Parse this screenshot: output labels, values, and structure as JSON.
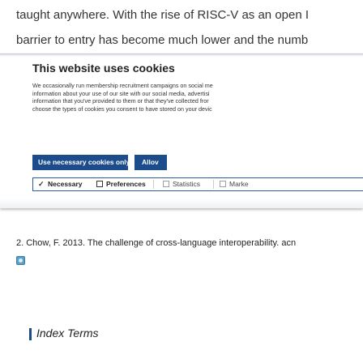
{
  "article": {
    "line1": "taught anywhere. With the rise of RISC-V as an open I",
    "line2": "barrier to entry has become much lower and the numb"
  },
  "cookie_banner": {
    "title": "This website uses cookies",
    "text_lines": [
      "We occasionally run membership recruitment campaigns on social me",
      "information about your use of our site with our social media, advertisi",
      "information that you've provided to them or that they've collected fror",
      "choose the types of cookies you consent to have stored on your devic"
    ],
    "buttons": {
      "necessary_only": "Use necessary cookies only",
      "allow": "Allov"
    },
    "preferences": {
      "necessary": "Necessary",
      "preferences": "Preferences",
      "statistics": "Statistics",
      "marketing": "Marke"
    },
    "checkbox_state": {
      "necessary": true,
      "preferences": false,
      "statistics": false,
      "marketing": false
    },
    "colors": {
      "button_bg": "#1c4c8c",
      "prefs_border": "#2a5aa0"
    }
  },
  "reference": {
    "text": "2. Chow, F. 2013. The challenge of cross-language interoperability. acn",
    "icon": "crossref-icon"
  },
  "index_terms": {
    "title": "Index Terms"
  }
}
